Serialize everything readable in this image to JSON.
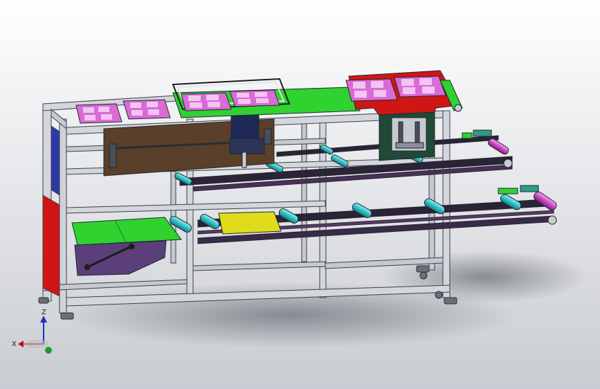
{
  "viewport": {
    "background_top": "#ffffff",
    "background_bottom": "#c9ccd2"
  },
  "triad": {
    "x_label": "X",
    "z_label": "Z",
    "x_color": "#c0141c",
    "y_color": "#1e9a2e",
    "z_color": "#1a2ec8"
  },
  "colors": {
    "frame": "#d3d6dc",
    "frame_edge": "#3b3f47",
    "belt_green": "#2fd22f",
    "tray_pink": "#d86bd6",
    "red_plate": "#d01515",
    "brown_panel": "#5a3f2a",
    "navy_block": "#1e2a55",
    "yellow_tray": "#e0dc1c",
    "roller_cyan": "#36c4c8",
    "roller_magenta": "#cc4ccc",
    "rail_dark": "#2b2436",
    "purple_bracket": "#5a3f7a",
    "dark_green_box": "#1f4a36",
    "teal_blocks": "#2f9a86"
  }
}
